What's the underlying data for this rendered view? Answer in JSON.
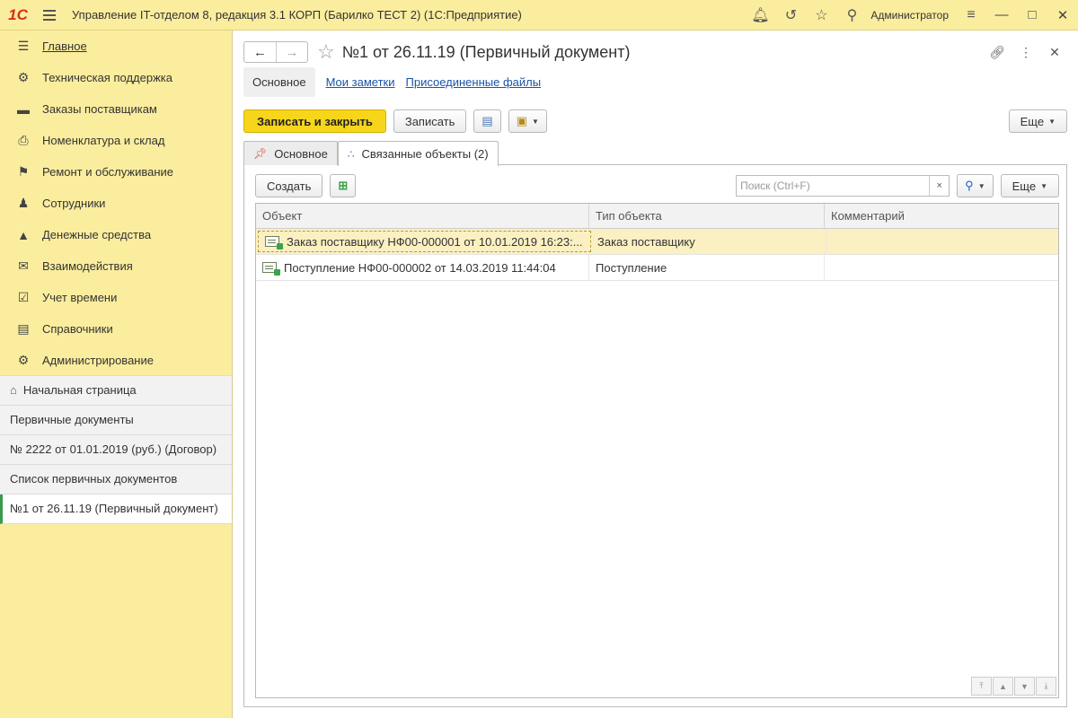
{
  "window": {
    "logo": "1С",
    "title": "Управление IT-отделом 8, редакция 3.1 КОРП (Барилко ТЕСТ 2)  (1С:Предприятие)",
    "user": "Администратор"
  },
  "sidebar": {
    "items": [
      {
        "label": "Главное",
        "icon": "menu-icon"
      },
      {
        "label": "Техническая поддержка",
        "icon": "support-icon"
      },
      {
        "label": "Заказы поставщикам",
        "icon": "truck-icon"
      },
      {
        "label": "Номенклатура и склад",
        "icon": "printer-icon"
      },
      {
        "label": "Ремонт и обслуживание",
        "icon": "flag-icon"
      },
      {
        "label": "Сотрудники",
        "icon": "users-icon"
      },
      {
        "label": "Денежные средства",
        "icon": "money-bag-icon"
      },
      {
        "label": "Взаимодействия",
        "icon": "envelope-icon"
      },
      {
        "label": "Учет времени",
        "icon": "calendar-icon"
      },
      {
        "label": "Справочники",
        "icon": "books-icon"
      },
      {
        "label": "Администрирование",
        "icon": "gear-icon"
      }
    ],
    "open_windows": [
      {
        "label": "Начальная страница"
      },
      {
        "label": "Первичные документы"
      },
      {
        "label": "№ 2222 от 01.01.2019 (руб.) (Договор)"
      },
      {
        "label": "Список первичных документов"
      },
      {
        "label": "№1 от 26.11.19 (Первичный документ)"
      }
    ]
  },
  "form": {
    "title": "№1 от 26.11.19 (Первичный документ)",
    "nav_tabs": [
      "Основное",
      "Мои заметки",
      "Присоединенные файлы"
    ],
    "toolbar": {
      "save_close": "Записать и закрыть",
      "save": "Записать",
      "more": "Еще"
    },
    "page_tabs": [
      "Основное",
      "Связанные объекты (2)"
    ],
    "panel": {
      "create": "Создать",
      "search_placeholder": "Поиск (Ctrl+F)",
      "clear": "×",
      "more": "Еще"
    },
    "table": {
      "columns": [
        "Объект",
        "Тип объекта",
        "Комментарий"
      ],
      "rows": [
        {
          "object": "Заказ поставщику НФ00-000001 от 10.01.2019 16:23:...",
          "type": "Заказ поставщику",
          "comment": "",
          "selected": true
        },
        {
          "object": "Поступление НФ00-000002 от 14.03.2019 11:44:04",
          "type": "Поступление",
          "comment": "",
          "selected": false
        }
      ]
    }
  },
  "colors": {
    "sidebar_bg": "#fbed9e",
    "primary_button": "#f6d51b",
    "selected_row": "#fbf0c2",
    "link": "#1a55a8",
    "active_marker": "#3b9a4b"
  }
}
